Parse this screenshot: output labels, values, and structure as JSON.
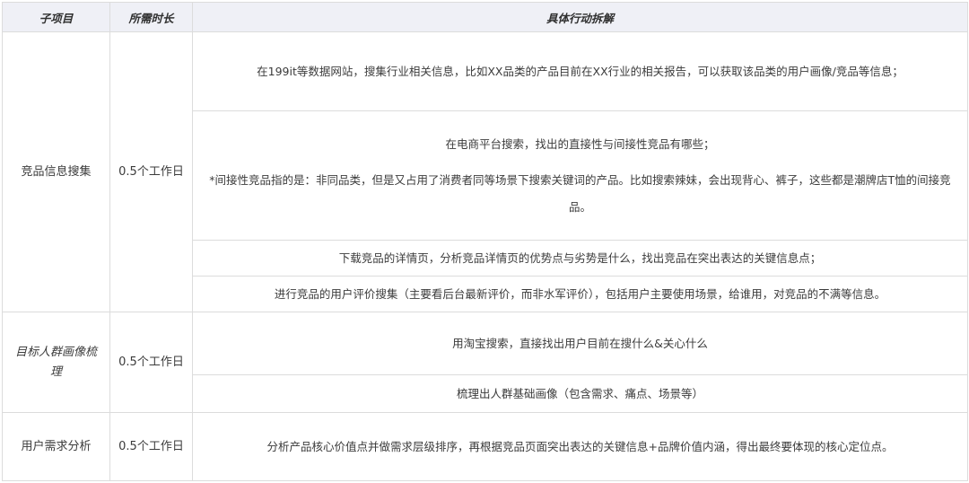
{
  "headers": {
    "subitem": "子项目",
    "duration": "所需时长",
    "actions": "具体行动拆解"
  },
  "groups": [
    {
      "subitem": "竞品信息搜集",
      "duration": "0.5个工作日",
      "actions": [
        "在199it等数据网站，搜集行业相关信息，比如XX品类的产品目前在XX行业的相关报告，可以获取该品类的用户画像/竞品等信息；",
        "在电商平台搜索，找出的直接性与间接性竞品有哪些；",
        "*间接性竞品指的是：非同品类，但是又占用了消费者同等场景下搜索关键词的产品。比如搜索辣妹，会出现背心、裤子，这些都是潮牌店T恤的间接竞品。",
        "下载竞品的详情页，分析竞品详情页的优势点与劣势是什么，找出竞品在突出表达的关键信息点；",
        "进行竞品的用户评价搜集（主要看后台最新评价，而非水军评价），包括用户主要使用场景，给谁用，对竞品的不满等信息。"
      ]
    },
    {
      "subitem": "目标人群画像梳理",
      "duration": "0.5个工作日",
      "actions": [
        "用淘宝搜索，直接找出用户目前在搜什么&关心什么",
        "梳理出人群基础画像（包含需求、痛点、场景等）"
      ]
    },
    {
      "subitem": "用户需求分析",
      "duration": "0.5个工作日",
      "actions": [
        "分析产品核心价值点并做需求层级排序，再根据竞品页面突出表达的关键信息+品牌价值内涵，得出最终要体现的核心定位点。"
      ]
    }
  ]
}
